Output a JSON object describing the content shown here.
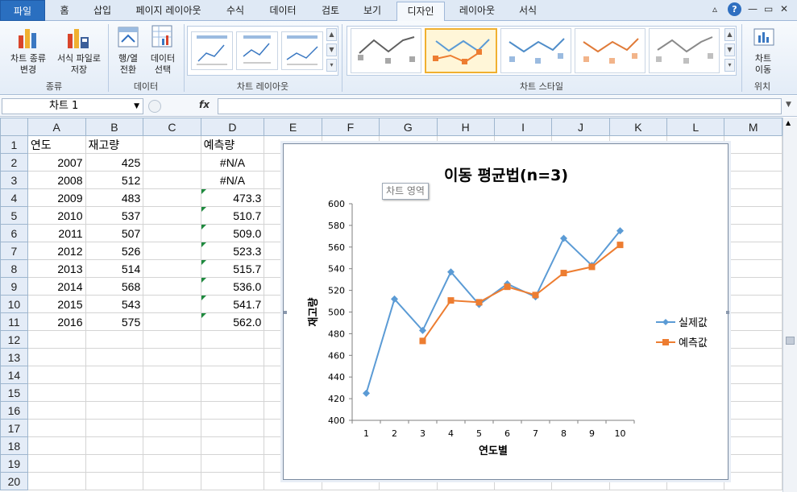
{
  "tabs": [
    "파일",
    "홈",
    "삽입",
    "페이지 레이아웃",
    "수식",
    "데이터",
    "검토",
    "보기",
    "디자인",
    "레이아웃",
    "서식"
  ],
  "active_tab": "디자인",
  "window_controls": [
    "▵",
    "?",
    "—",
    "▭",
    "✕"
  ],
  "ribbon": {
    "groups": {
      "type": {
        "label": "종류",
        "buttons": [
          "차트 종류\n변경",
          "서식 파일로\n저장"
        ]
      },
      "data": {
        "label": "데이터",
        "buttons": [
          "행/열\n전환",
          "데이터\n선택"
        ]
      },
      "layouts": {
        "label": "차트 레이아웃"
      },
      "styles": {
        "label": "차트 스타일"
      },
      "location": {
        "label": "위치",
        "buttons": [
          "차트\n이동"
        ]
      }
    }
  },
  "name_box": "차트 1",
  "fx_label": "fx",
  "sheet": {
    "columns": [
      "A",
      "B",
      "C",
      "D",
      "E",
      "F",
      "G",
      "H",
      "I",
      "J",
      "K",
      "L",
      "M"
    ],
    "rows": [
      [
        "연도",
        "재고량",
        "",
        "예측량"
      ],
      [
        "2007",
        "425",
        "",
        "#N/A"
      ],
      [
        "2008",
        "512",
        "",
        "#N/A"
      ],
      [
        "2009",
        "483",
        "",
        "473.3"
      ],
      [
        "2010",
        "537",
        "",
        "510.7"
      ],
      [
        "2011",
        "507",
        "",
        "509.0"
      ],
      [
        "2012",
        "526",
        "",
        "523.3"
      ],
      [
        "2013",
        "514",
        "",
        "515.7"
      ],
      [
        "2014",
        "568",
        "",
        "536.0"
      ],
      [
        "2015",
        "543",
        "",
        "541.7"
      ],
      [
        "2016",
        "575",
        "",
        "562.0"
      ],
      [
        "",
        "",
        "",
        ""
      ],
      [
        "",
        "",
        "",
        ""
      ],
      [
        "",
        "",
        "",
        ""
      ],
      [
        "",
        "",
        "",
        ""
      ],
      [
        "",
        "",
        "",
        ""
      ],
      [
        "",
        "",
        "",
        ""
      ],
      [
        "",
        "",
        "",
        ""
      ],
      [
        "",
        "",
        "",
        ""
      ],
      [
        "",
        "",
        "",
        ""
      ]
    ]
  },
  "tooltip": "차트 영역",
  "chart_data": {
    "type": "line",
    "title": "이동 평균법(n=3)",
    "xlabel": "연도별",
    "ylabel": "재고량",
    "categories": [
      1,
      2,
      3,
      4,
      5,
      6,
      7,
      8,
      9,
      10
    ],
    "ylim": [
      400,
      600
    ],
    "ytick_step": 20,
    "grid": false,
    "legend_position": "right",
    "series": [
      {
        "name": "실제값",
        "values": [
          425,
          512,
          483,
          537,
          507,
          526,
          514,
          568,
          543,
          575
        ],
        "color": "#5b9bd5",
        "marker": "diamond"
      },
      {
        "name": "예측값",
        "values": [
          null,
          null,
          473.3,
          510.7,
          509.0,
          523.3,
          515.7,
          536.0,
          541.7,
          562.0
        ],
        "color": "#ed7d31",
        "marker": "square"
      }
    ]
  },
  "colors": {
    "accent": "#2a6fc0",
    "ribbon_bg": "#e3ecf7",
    "header_bg": "#e4ecf7"
  }
}
